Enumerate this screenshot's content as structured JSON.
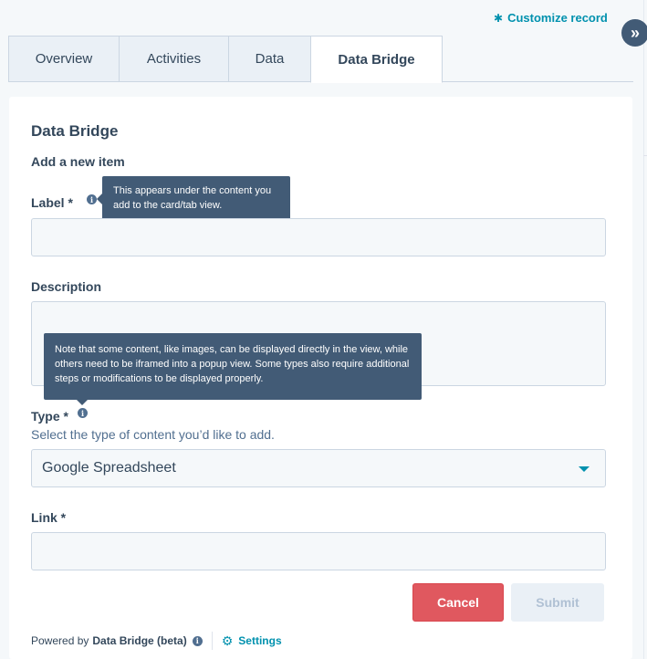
{
  "header": {
    "customize_label": "Customize record",
    "customize_icon": "gear-icon",
    "expand_icon": "chevrons-right-icon"
  },
  "tabs": [
    {
      "label": "Overview",
      "active": false
    },
    {
      "label": "Activities",
      "active": false
    },
    {
      "label": "Data",
      "active": false
    },
    {
      "label": "Data Bridge",
      "active": true
    }
  ],
  "form": {
    "title": "Data Bridge",
    "subtitle": "Add a new item",
    "label_field": {
      "label": "Label *",
      "value": "",
      "tooltip": "This appears under the content you add to the card/tab view."
    },
    "description_field": {
      "label": "Description",
      "value": "",
      "tooltip": "Note that some content, like images, can be displayed directly in the view, while others need to be iframed into a popup view. Some types also require additional steps or modifications to be displayed properly."
    },
    "type_field": {
      "label": "Type *",
      "help": "Select the type of content you’d like to add.",
      "selected": "Google Spreadsheet"
    },
    "link_field": {
      "label": "Link *",
      "value": ""
    },
    "cancel_label": "Cancel",
    "submit_label": "Submit"
  },
  "footer": {
    "powered_by": "Powered by",
    "product": "Data Bridge (beta)",
    "settings_label": "Settings"
  },
  "colors": {
    "accent": "#0091ae",
    "cancel": "#e0585f",
    "tooltip": "#425b76"
  }
}
